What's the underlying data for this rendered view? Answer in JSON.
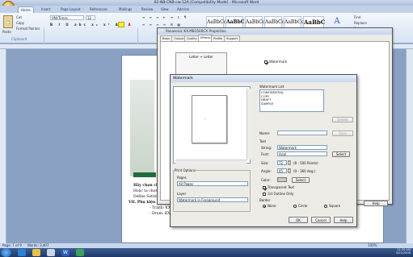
{
  "window": {
    "title": "02-NB-CNB-cw-12A [Compatibility Mode] - Microsoft Word"
  },
  "ribbon": {
    "tabs": [
      {
        "label": "Home",
        "active": true
      },
      {
        "label": "Insert",
        "active": false
      },
      {
        "label": "Page Layout",
        "active": false
      },
      {
        "label": "References",
        "active": false
      },
      {
        "label": "Mailings",
        "active": false
      },
      {
        "label": "Review",
        "active": false
      },
      {
        "label": "View",
        "active": false
      },
      {
        "label": "Add-Ins",
        "active": false
      }
    ],
    "clipboard": {
      "paste": "Paste",
      "cut": "Cut",
      "copy": "Copy",
      "format_painter": "Format Painter",
      "group": "Clipboard"
    },
    "font": {
      "name": "VNI-Times",
      "size": "12"
    },
    "styles": [
      {
        "preview": "AaBbCcI",
        "name": "¶ Normal"
      },
      {
        "preview": "AaBbC",
        "name": "¶ No Spaci..."
      },
      {
        "preview": "AaBbCc",
        "name": "Heading 1"
      },
      {
        "preview": "AaBbCc",
        "name": "Heading 2"
      },
      {
        "preview": "AaBbCcI",
        "name": "Heading 3"
      },
      {
        "preview": "AaBbC",
        "name": "Title"
      }
    ],
    "change_styles": "Change Styles",
    "find": "Find",
    "replace": "Replace",
    "select": "Select"
  },
  "document": {
    "lines": [
      "Hãy chọn chế độ",
      "Hoặc ta chọn ch",
      "Define Settings.",
      "VII. Phụ kiện kê m",
      "- Trành: KX",
      "- Drum: KX"
    ]
  },
  "statusbar": {
    "page": "Page: 7 of 9",
    "words": "Words: 3,407",
    "zoom": "100%"
  },
  "taskbar": {
    "time": "11:35 AM",
    "date": "3/25/2008"
  },
  "properties_dialog": {
    "title": "Panasonic KX-MB1500CX Properties",
    "tabs": [
      {
        "label": "Basic",
        "active": false
      },
      {
        "label": "Output",
        "active": false
      },
      {
        "label": "Quality",
        "active": false
      },
      {
        "label": "Effects",
        "active": true
      },
      {
        "label": "Profile",
        "active": false
      },
      {
        "label": "Support",
        "active": false
      }
    ],
    "paper_label": "Letter + Letter",
    "watermark_check": "Watermark",
    "edit_button": "Edit...",
    "help_button": "Help"
  },
  "watermark_dialog": {
    "title": "Watermark",
    "list_label": "Watermark List",
    "list_items": [
      "CONFIDENTIAL",
      "COPY",
      "DRAFT",
      "SAMPLE"
    ],
    "delete_button": "Delete",
    "name_label": "Name:",
    "name_value": "",
    "save_button": "Save",
    "text_group": "Text",
    "string_label": "String:",
    "string_value": "Watermark",
    "font_label": "Font:",
    "font_value": "Arial",
    "select_button": "Select",
    "size_label": "Size:",
    "size_value": "72",
    "size_range": "(8 - 500 Points)",
    "angle_label": "Angle:",
    "angle_value": "45",
    "angle_range": "(0 - 360 deg.)",
    "color_label": "Color:",
    "color_button": "Select",
    "transparent_text": "Transparent Text",
    "outline_only": "1st Outline Only",
    "border_group": "Border",
    "border_options": [
      {
        "label": "None",
        "selected": true
      },
      {
        "label": "Circle",
        "selected": false
      },
      {
        "label": "Square",
        "selected": false
      }
    ],
    "print_options_group": "Print Options",
    "pages_label": "Pages",
    "pages_value": "All Pages",
    "layer_label": "Layer",
    "layer_value": "Watermark in Foreground",
    "ok_button": "OK",
    "cancel_button": "Cancel",
    "help_button": "Help"
  }
}
